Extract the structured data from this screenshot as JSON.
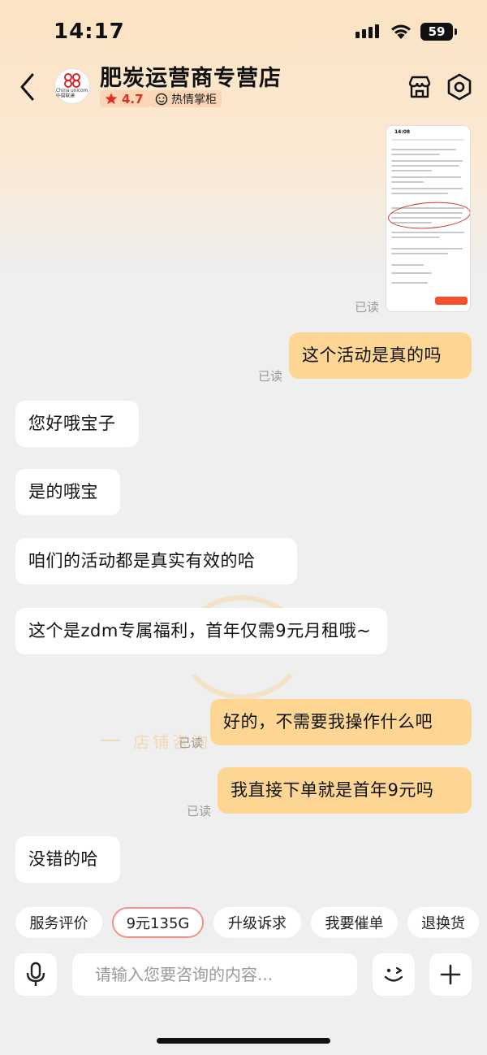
{
  "status_bar": {
    "time": "14:17",
    "battery": "59"
  },
  "header": {
    "shop_name": "肥炭运营商专营店",
    "logo_text": "China unicom中国联通",
    "rating": "4.7",
    "badge": "热情掌柜",
    "icons": [
      "back-chevron-icon",
      "store-icon",
      "settings-hexagon-icon"
    ]
  },
  "chat": {
    "shared_image": {
      "time": "14:08",
      "read": "已读"
    },
    "messages": [
      {
        "side": "mine",
        "text": "这个活动是真的吗",
        "read": "已读"
      },
      {
        "side": "theirs",
        "text": "您好哦宝子"
      },
      {
        "side": "theirs",
        "text": "是的哦宝"
      },
      {
        "side": "theirs",
        "text": "咱们的活动都是真实有效的哈"
      },
      {
        "side": "theirs",
        "text": "这个是zdm专属福利，首年仅需9元月租哦~"
      },
      {
        "side": "mine",
        "text": "好的，不需要我操作什么吧",
        "read": "已读"
      },
      {
        "side": "mine",
        "text": "我直接下单就是首年9元吗",
        "read": "已读"
      },
      {
        "side": "theirs",
        "text": "没错的哈"
      }
    ],
    "watermark": "店铺咨询"
  },
  "quick_replies": [
    {
      "label": "服务评价",
      "active": false
    },
    {
      "label": "9元135G",
      "active": true
    },
    {
      "label": "升级诉求",
      "active": false
    },
    {
      "label": "我要催单",
      "active": false
    },
    {
      "label": "退换货",
      "active": false
    }
  ],
  "input_bar": {
    "placeholder": "请输入您要咨询的内容...",
    "icons": [
      "microphone-icon",
      "emoji-wink-icon",
      "plus-icon"
    ]
  },
  "colors": {
    "accent_red": "#e02e24",
    "bubble_mine": "#fcd692",
    "bubble_theirs": "#ffffff",
    "header_gradient": "#fbe3c3"
  }
}
